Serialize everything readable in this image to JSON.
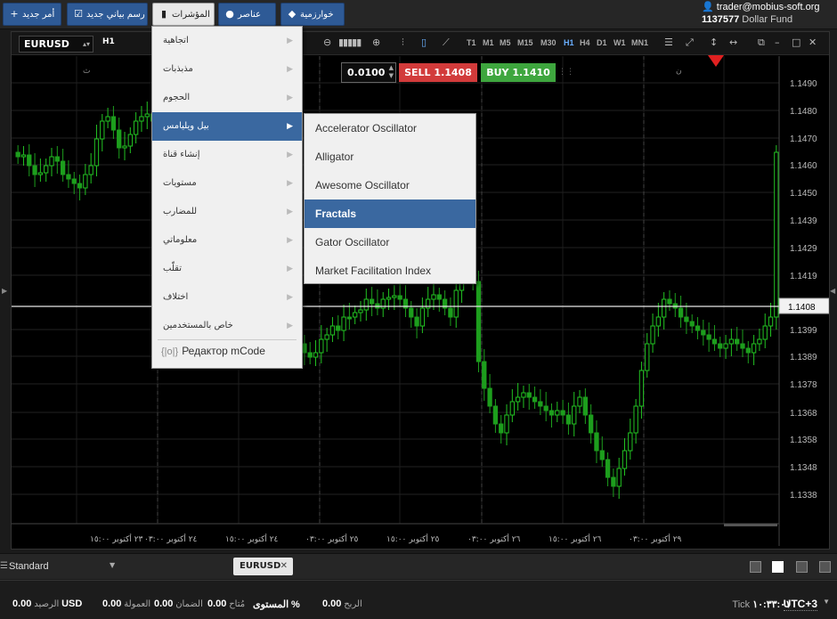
{
  "toolbar": {
    "new_order": "أمر جديد",
    "new_chart": "رسم بياني جديد",
    "indicators": "المؤشرات",
    "elements": "عناصر",
    "algorithms": "خوارزمية"
  },
  "account": {
    "email": "trader@mobius-soft.org",
    "number": "1137577",
    "fund": "Dollar Fund"
  },
  "chart": {
    "symbol": "EURUSD",
    "timeframe_label": "H1",
    "timeframes": [
      "T1",
      "M1",
      "M5",
      "M15",
      "M30",
      "H1",
      "H4",
      "D1",
      "W1",
      "MN1"
    ],
    "selected_timeframe": "H1",
    "current_price": "1.1408",
    "price_ticks": [
      "1.1490",
      "1.1480",
      "1.1470",
      "1.1460",
      "1.1450",
      "1.1439",
      "1.1429",
      "1.1419",
      "1.1399",
      "1.1389",
      "1.1378",
      "1.1368",
      "1.1358",
      "1.1348",
      "1.1338"
    ],
    "time_ticks": [
      "٢٣ أكتوبر ١٥:٠٠",
      "٢٤ أكتوبر ٠٣:٠٠",
      "٢٤ أكتوبر ١٥:٠٠",
      "٢٥ أكتوبر ٠٣:٠٠",
      "٢٥ أكتوبر ١٥:٠٠",
      "٢٦ أكتوبر ٠٣:٠٠",
      "٢٦ أكتوبر ١٥:٠٠",
      "٢٩ أكتوبر ٠٣:٠٠"
    ],
    "session_marks": [
      "ث",
      "ن"
    ],
    "up_color": "#22c322",
    "down_color": "#1d9e1d"
  },
  "trade": {
    "lot": "0.0100",
    "sell_label": "SELL",
    "sell_price": "1.1408",
    "buy_label": "BUY",
    "buy_price": "1.1410"
  },
  "menu": {
    "items": [
      {
        "label": "اتجاهية"
      },
      {
        "label": "مذبذبات"
      },
      {
        "label": "الحجوم"
      },
      {
        "label": "بيل ويليامس"
      },
      {
        "label": "إنشاء قناة"
      },
      {
        "label": "مستويات"
      },
      {
        "label": "للمضارب"
      },
      {
        "label": "معلوماتي"
      },
      {
        "label": "تقلّب"
      },
      {
        "label": "اختلاف"
      },
      {
        "label": "خاص بالمستخدمين"
      }
    ],
    "highlighted_index": 3,
    "mcode_label": "Редактор mCode",
    "mcode_icon": "{|o|}"
  },
  "submenu": {
    "items": [
      {
        "label": "Accelerator Oscillator"
      },
      {
        "label": "Alligator"
      },
      {
        "label": "Awesome Oscillator"
      },
      {
        "label": "Fractals"
      },
      {
        "label": "Gator Oscillator"
      },
      {
        "label": "Market Facilitation Index"
      }
    ],
    "highlighted_index": 3
  },
  "bottom": {
    "workspace": "Standard",
    "tab": "EURUSD"
  },
  "status": {
    "balance_label": "الرصيد",
    "balance_value": "0.00",
    "currency": "USD",
    "commission_label": "العمولة",
    "commission_value": "0.00",
    "margin_label": "الضمان",
    "margin_value": "0.00",
    "available_label": "مُتاح",
    "available_value": "0.00",
    "level_label": "المستوى",
    "level_value": "%",
    "profit_label": "الربح",
    "profit_value": "0.00",
    "tick_label": "Tick",
    "time_value": "١٠:٣٣:٠١",
    "utc": "UTC+3"
  }
}
